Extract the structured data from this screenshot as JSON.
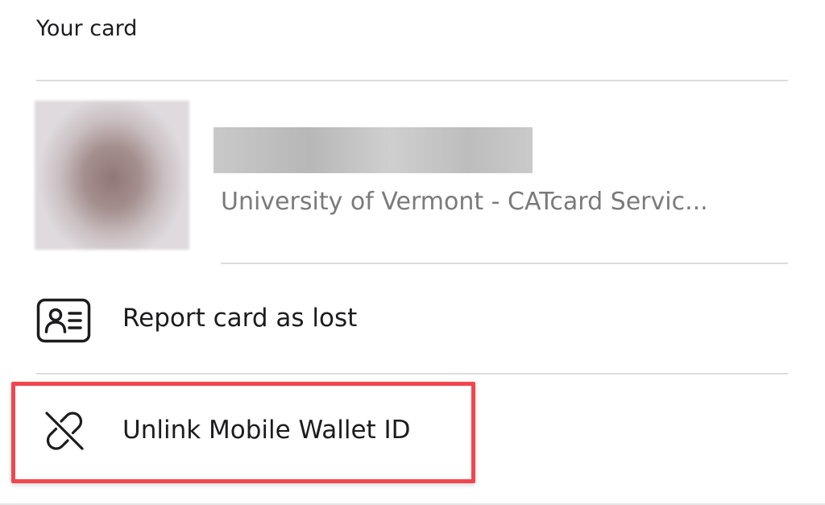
{
  "section": {
    "title": "Your card"
  },
  "card": {
    "institution": "University of Vermont - CATcard Servic..."
  },
  "menu": {
    "items": [
      {
        "label": "Report card as lost",
        "icon": "id-card-icon"
      },
      {
        "label": "Unlink Mobile Wallet ID",
        "icon": "unlink-icon"
      }
    ]
  },
  "colors": {
    "highlight": "#f0464e",
    "divider": "#dcdcdc",
    "secondary_text": "#7a7a7a"
  }
}
